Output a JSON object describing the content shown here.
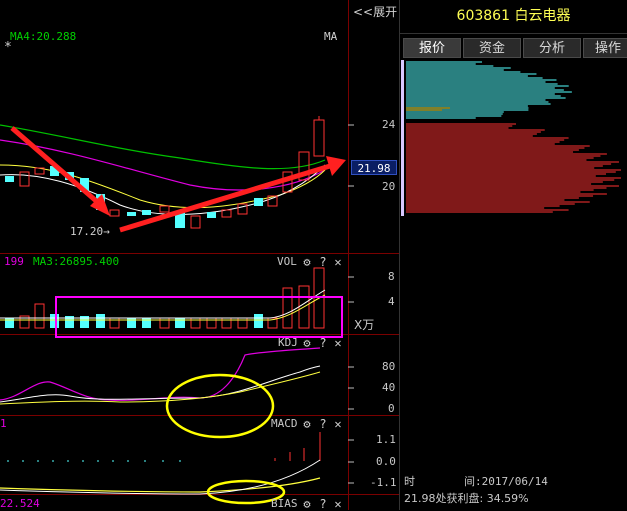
{
  "stock": {
    "title": "603861 白云电器",
    "expand_label": "<<展开"
  },
  "main_chart": {
    "ma_label": "MA4:20.288",
    "ma_short": "MA",
    "star": "*",
    "low_annotation": "17.20→",
    "price_ticks": [
      "24",
      "20"
    ],
    "current_price": "21.98"
  },
  "vol_panel": {
    "label_left": "199",
    "label_ma3": "MA3:26895.400",
    "label": "VOL",
    "ticks": [
      "8",
      "4"
    ],
    "unit": "X万"
  },
  "kdj_panel": {
    "label": "KDJ",
    "ticks": [
      "80",
      "40",
      "0"
    ]
  },
  "macd_panel": {
    "label_left": "1",
    "label": "MACD",
    "ticks": [
      "1.1",
      "0.0",
      "-1.1"
    ]
  },
  "bias_panel": {
    "label_left": "22.524",
    "label": "BIAS"
  },
  "tabs": [
    {
      "label": "报价",
      "active": true
    },
    {
      "label": "资金",
      "active": false
    },
    {
      "label": "分析",
      "active": false
    },
    {
      "label": "操作",
      "active": false
    }
  ],
  "info": {
    "time_label": "时",
    "time_value": "间:2017/06/14",
    "profit_line": "21.98处获利盘: 34.59%"
  },
  "colors": {
    "up": "#ff3232",
    "down": "#54ffff",
    "accent": "#ffff54",
    "ma_green": "#00d000",
    "magenta": "#ff00ff"
  }
}
